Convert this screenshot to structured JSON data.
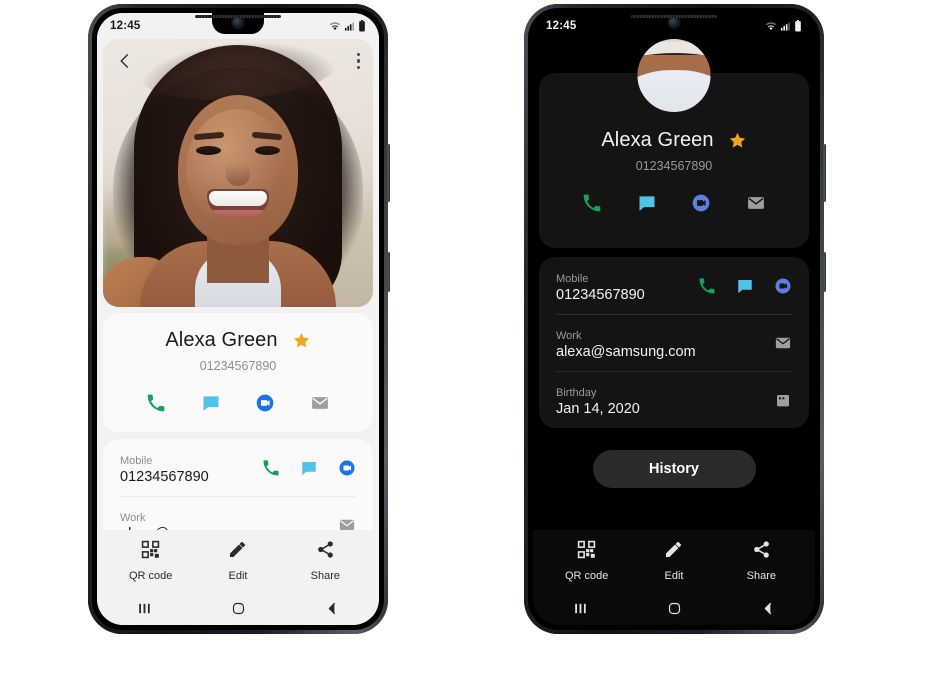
{
  "status_bar": {
    "time": "12:45",
    "icons": [
      "wifi-icon",
      "signal-icon",
      "battery-icon"
    ]
  },
  "contact": {
    "name": "Alexa Green",
    "number": "01234567890",
    "favorite": true,
    "star_color": "#f2a71b"
  },
  "quick_actions": [
    {
      "name": "call-action",
      "icon": "phone-icon",
      "color": "#17a05e"
    },
    {
      "name": "message-action",
      "icon": "message-icon",
      "color": "#4fc3e8"
    },
    {
      "name": "video-action",
      "icon": "duo-video-icon",
      "color": "#1a73e8"
    },
    {
      "name": "email-action",
      "icon": "mail-icon",
      "color": "#9e9e9e"
    }
  ],
  "details": [
    {
      "label": "Mobile",
      "value": "01234567890",
      "actions": [
        {
          "name": "call-action",
          "icon": "phone-icon",
          "color": "#17a05e"
        },
        {
          "name": "message-action",
          "icon": "message-icon",
          "color": "#4fc3e8"
        },
        {
          "name": "video-action",
          "icon": "duo-video-icon",
          "color": "#1a73e8"
        }
      ]
    },
    {
      "label": "Work",
      "value": "alexa@samsung.com",
      "actions": [
        {
          "name": "email-action",
          "icon": "mail-icon",
          "color": "#9e9e9e"
        }
      ]
    },
    {
      "label": "Birthday",
      "value": "Jan 14, 2020",
      "actions": [
        {
          "name": "calendar-action",
          "icon": "calendar-icon",
          "color": "#9e9e9e"
        }
      ]
    }
  ],
  "history_button": {
    "label": "History"
  },
  "bottom_actions": [
    {
      "name": "qr-code-button",
      "label": "QR code",
      "icon": "qr-code-icon"
    },
    {
      "name": "edit-button",
      "label": "Edit",
      "icon": "pencil-icon"
    },
    {
      "name": "share-button",
      "label": "Share",
      "icon": "share-icon"
    }
  ],
  "nav_bar": [
    {
      "name": "recents-button",
      "icon": "recents-icon"
    },
    {
      "name": "home-button",
      "icon": "home-circle-icon"
    },
    {
      "name": "back-button",
      "icon": "back-chevron-icon"
    }
  ],
  "photo_header": {
    "back": "back-chevron-icon",
    "menu": "more-options-icon"
  }
}
